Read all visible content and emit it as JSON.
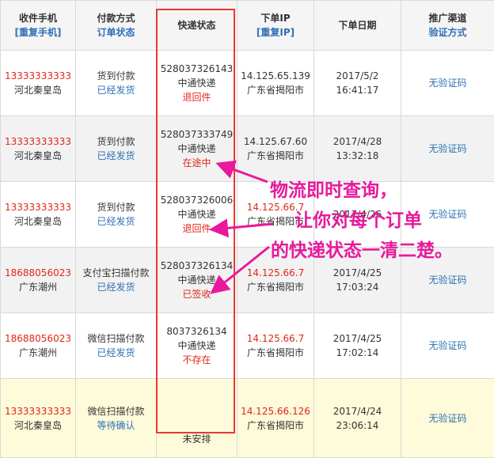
{
  "headers": {
    "phone": "收件手机",
    "phone_link": "[重复手机]",
    "pay": "付款方式",
    "pay_sub": "订单状态",
    "express": "快递状态",
    "ip": "下单IP",
    "ip_link": "[重复IP]",
    "date": "下单日期",
    "channel": "推广渠道",
    "channel_sub": "验证方式"
  },
  "rows": [
    {
      "phone": "13333333333",
      "region": "河北秦皇岛",
      "pay": "货到付款",
      "order_status": "已经发货",
      "tracking": "528037326143",
      "courier": "中通快递",
      "express_status": "退回件",
      "ip": "14.125.65.139",
      "ip_loc": "广东省揭阳市",
      "date": "2017/5/2",
      "time": "16:41:17",
      "verify": "无验证码"
    },
    {
      "phone": "13333333333",
      "region": "河北秦皇岛",
      "pay": "货到付款",
      "order_status": "已经发货",
      "tracking": "528037333749",
      "courier": "中通快递",
      "express_status": "在途中",
      "ip": "14.125.67.60",
      "ip_loc": "广东省揭阳市",
      "date": "2017/4/28",
      "time": "13:32:18",
      "verify": "无验证码"
    },
    {
      "phone": "13333333333",
      "region": "河北秦皇岛",
      "pay": "货到付款",
      "order_status": "已经发货",
      "tracking": "528037326006",
      "courier": "中通快递",
      "express_status": "退回件",
      "ip": "14.125.66.7",
      "ip_loc": "广东省揭阳市",
      "date": "2017/4/26",
      "time": "",
      "verify": "无验证码"
    },
    {
      "phone": "18688056023",
      "region": "广东潮州",
      "pay": "支付宝扫描付款",
      "order_status": "已经发货",
      "tracking": "528037326134",
      "courier": "中通快递",
      "express_status": "已签收",
      "ip": "14.125.66.7",
      "ip_loc": "广东省揭阳市",
      "date": "2017/4/25",
      "time": "17:03:24",
      "verify": "无验证码"
    },
    {
      "phone": "18688056023",
      "region": "广东潮州",
      "pay": "微信扫描付款",
      "order_status": "已经发货",
      "tracking": "8037326134",
      "courier": "中通快递",
      "express_status": "不存在",
      "ip": "14.125.66.7",
      "ip_loc": "广东省揭阳市",
      "date": "2017/4/25",
      "time": "17:02:14",
      "verify": "无验证码"
    },
    {
      "phone": "13333333333",
      "region": "河北秦皇岛",
      "pay": "微信扫描付款",
      "order_status": "等待确认",
      "tracking": "",
      "courier": "",
      "express_status": "未安排",
      "ip": "14.125.66.126",
      "ip_loc": "广东省揭阳市",
      "date": "2017/4/24",
      "time": "23:06:14",
      "verify": "无验证码"
    }
  ],
  "callout": {
    "line1": "物流即时查询，",
    "line2": "让你对每个订单",
    "line3": "的快递状态一清二楚。"
  },
  "colors": {
    "accent_red": "#e0261b",
    "link_blue": "#2f6fb6",
    "annotation_pink": "#e8199b",
    "highlight_box": "#e53935"
  }
}
